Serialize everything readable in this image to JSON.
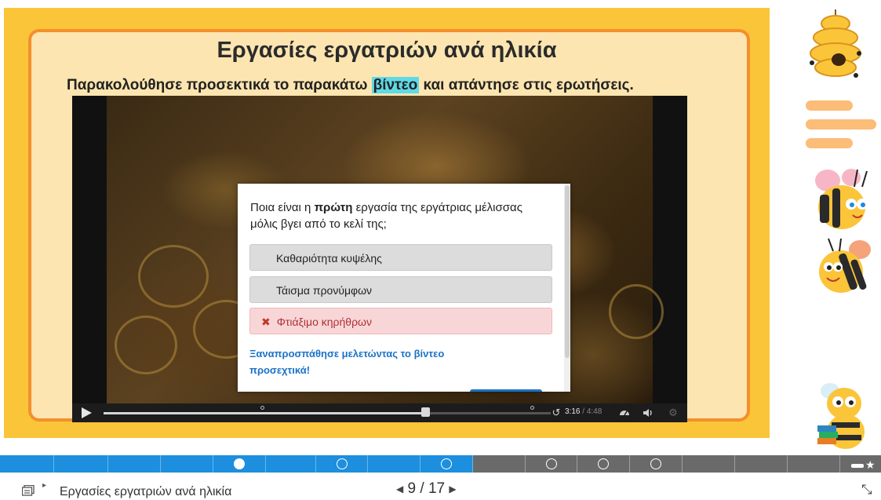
{
  "slide": {
    "title": "Εργασίες εργατριών ανά ηλικία",
    "instructions_before": "Παρακολούθησε προσεκτικά το παρακάτω ",
    "instructions_highlight": "βίντεο",
    "instructions_after": " και απάντησε στις ερωτήσεις."
  },
  "video": {
    "current_time": "3:16",
    "separator": " / ",
    "duration": "4:48",
    "progress_fraction": 0.72,
    "controls": [
      "play-icon",
      "speed-icon",
      "volume-icon",
      "settings-icon"
    ]
  },
  "quiz": {
    "question_before": "Ποια είναι η ",
    "question_bold": "πρώτη",
    "question_after": " εργασία της εργάτριας μέλισσας μόλις βγει από το κελί της;",
    "answers": [
      {
        "label": "Καθαριότητα κυψέλης",
        "state": "neutral"
      },
      {
        "label": "Τάισμα προνύμφων",
        "state": "neutral"
      },
      {
        "label": "Φτιάξιμο κηρήθρων",
        "state": "wrong"
      }
    ],
    "wrong_mark": "✖",
    "feedback": "Ξαναπροσπάθησε μελετώντας το βίντεο προσεχτικά!"
  },
  "progress": {
    "current_index": 9,
    "total": 17,
    "accent": "#1d8fde"
  },
  "footer": {
    "title": "Εργασίες εργατριών ανά ηλικία",
    "page_current": "9",
    "page_separator": "/",
    "page_total": "17",
    "prev_arrow": "◀",
    "next_arrow": "▶",
    "caret": "▸",
    "fullscreen_glyph": "⤡"
  },
  "colors": {
    "slide_background": "#fbc53a",
    "slide_panel": "#fce5b0",
    "slide_border": "#f48f2c",
    "highlight": "#5fd9e7",
    "feedback": "#1a73c7"
  }
}
